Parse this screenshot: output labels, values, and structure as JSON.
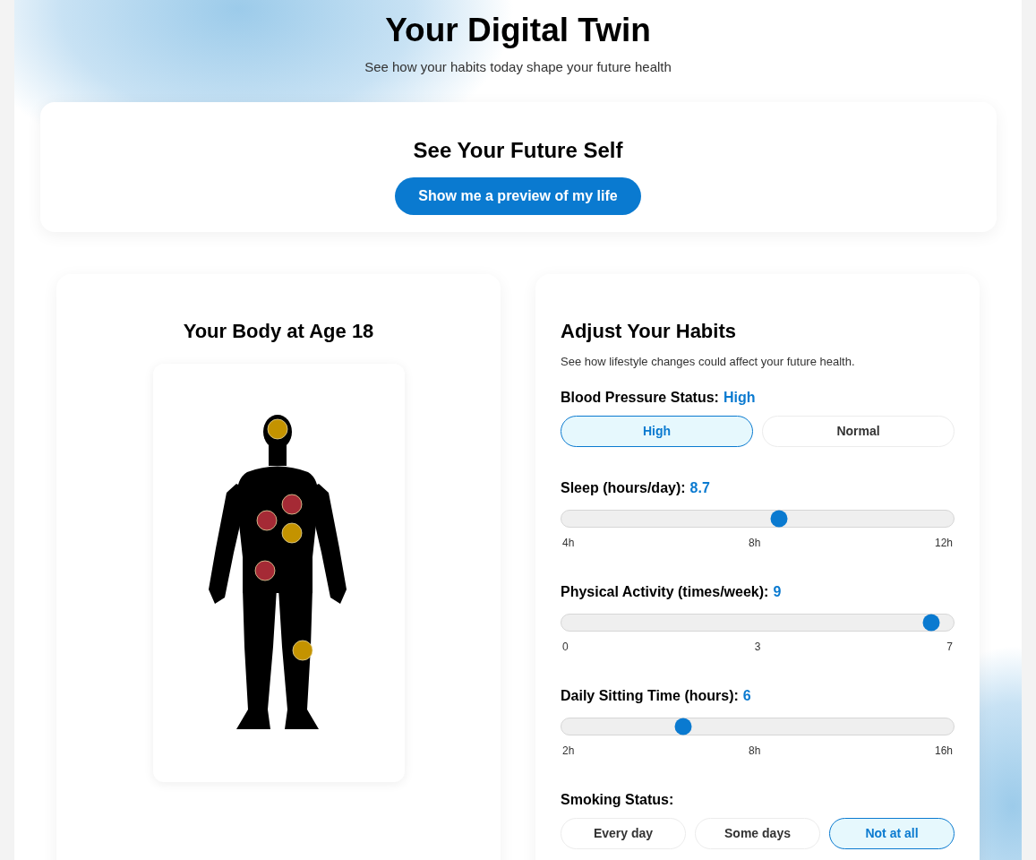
{
  "header": {
    "title": "Your Digital Twin",
    "subtitle": "See how your habits today shape your future health"
  },
  "preview_card": {
    "title": "See Your Future Self",
    "button": "Show me a preview of my life"
  },
  "body_panel": {
    "title": "Your Body at Age 18",
    "markers": [
      {
        "color": "#c49300"
      },
      {
        "color": "#a52a35"
      },
      {
        "color": "#a52a35"
      },
      {
        "color": "#c49300"
      },
      {
        "color": "#a52a35"
      },
      {
        "color": "#c49300"
      }
    ]
  },
  "habits_panel": {
    "title": "Adjust Your Habits",
    "description": "See how lifestyle changes could affect your future health.",
    "controls": [
      {
        "kind": "choice",
        "label": "Blood Pressure Status:",
        "value": "High",
        "options": [
          {
            "label": "High",
            "selected": true
          },
          {
            "label": "Normal",
            "selected": false
          }
        ]
      },
      {
        "kind": "slider",
        "label": "Sleep (hours/day):",
        "value": "8.7",
        "level": 0.555,
        "ticks": [
          "4h",
          "8h",
          "12h"
        ]
      },
      {
        "kind": "slider",
        "label": "Physical Activity (times/week):",
        "value": "9",
        "level": 0.944,
        "ticks": [
          "0",
          "3",
          "7"
        ]
      },
      {
        "kind": "slider",
        "label": "Daily Sitting Time (hours):",
        "value": "6",
        "level": 0.31,
        "ticks": [
          "2h",
          "8h",
          "16h"
        ]
      },
      {
        "kind": "choice",
        "label": "Smoking Status:",
        "options": [
          {
            "label": "Every day",
            "selected": false
          },
          {
            "label": "Some days",
            "selected": false
          },
          {
            "label": "Not at all",
            "selected": true
          }
        ]
      }
    ]
  }
}
